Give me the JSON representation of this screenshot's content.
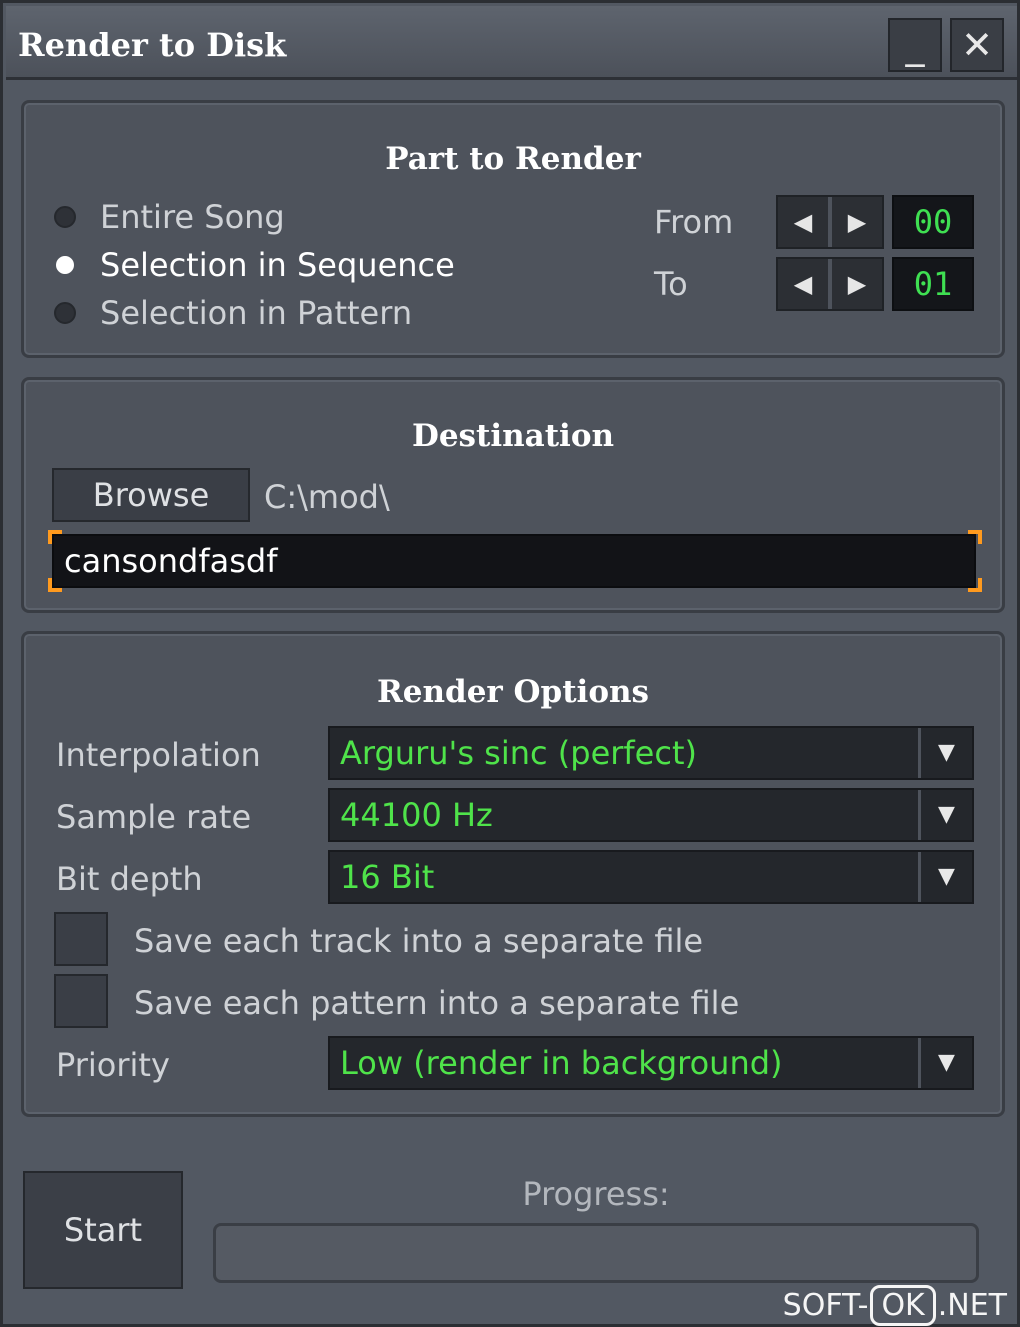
{
  "window": {
    "title": "Render to Disk",
    "minimize": "_",
    "close": "✕"
  },
  "part_to_render": {
    "title": "Part to Render",
    "options": [
      {
        "label": "Entire Song",
        "selected": false
      },
      {
        "label": "Selection in Sequence",
        "selected": true
      },
      {
        "label": "Selection in Pattern",
        "selected": false
      }
    ],
    "from_label": "From",
    "to_label": "To",
    "from_value": "00",
    "to_value": "01",
    "left_arrow": "◀",
    "right_arrow": "▶"
  },
  "destination": {
    "title": "Destination",
    "browse_label": "Browse",
    "path": "C:\\mod\\",
    "filename": "cansondfasdf"
  },
  "render_options": {
    "title": "Render Options",
    "interpolation_label": "Interpolation",
    "interpolation_value": "Arguru's sinc (perfect)",
    "sample_rate_label": "Sample rate",
    "sample_rate_value": "44100 Hz",
    "bit_depth_label": "Bit depth",
    "bit_depth_value": "16 Bit",
    "save_tracks_label": "Save each track into a separate file",
    "save_patterns_label": "Save each pattern into a separate file",
    "priority_label": "Priority",
    "priority_value": "Low (render in background)",
    "dropdown_arrow": "▼"
  },
  "footer": {
    "start_label": "Start",
    "progress_label": "Progress:",
    "progress": 0
  },
  "watermark": {
    "left": "SOFT-",
    "box": "OK",
    "right": ".NET"
  }
}
